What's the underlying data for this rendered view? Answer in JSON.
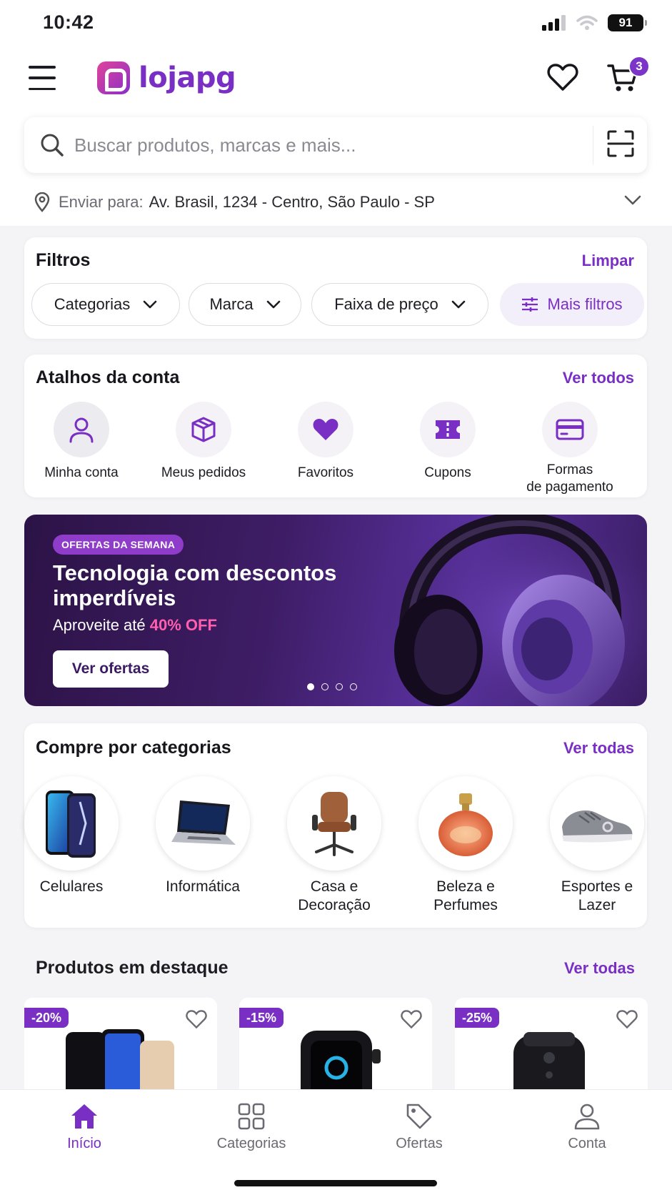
{
  "status_bar": {
    "time": "10:42",
    "battery": "91"
  },
  "header": {
    "logo_text": "lojapg",
    "cart_count": "3"
  },
  "search": {
    "placeholder": "Buscar produtos, marcas e mais...",
    "value": ""
  },
  "address": {
    "label": "Enviar para:",
    "value": "Av. Brasil, 1234 - Centro, São Paulo - SP"
  },
  "filters": {
    "title": "Filtros",
    "clear_label": "Limpar",
    "chips": [
      "Categorias",
      "Marca",
      "Faixa de preço",
      "Mais filtros"
    ]
  },
  "shortcuts": {
    "title": "Atalhos da conta",
    "link": "Ver todos",
    "items": [
      {
        "label": "Minha conta",
        "icon": "user-icon"
      },
      {
        "label": "Meus pedidos",
        "icon": "box-icon"
      },
      {
        "label": "Favoritos",
        "icon": "heart-icon"
      },
      {
        "label": "Cupons",
        "icon": "ticket-icon"
      },
      {
        "label": "Formas\nde pagamento",
        "icon": "credit-card-icon"
      }
    ]
  },
  "banner": {
    "badge": "OFERTAS DA SEMANA",
    "title": "Tecnologia com descontos imperdíveis",
    "subtitle_prefix": "Aproveite até",
    "subtitle_highlight": "40% OFF",
    "button": "Ver ofertas",
    "slides": 4,
    "active_slide": 1
  },
  "categories": {
    "title": "Compre por categorias",
    "link": "Ver todas",
    "items": [
      {
        "label": "Celulares",
        "icon": "smartphone-image"
      },
      {
        "label": "Informática",
        "icon": "laptop-image"
      },
      {
        "label": "Casa e\nDecoração",
        "icon": "chair-image"
      },
      {
        "label": "Beleza e\nPerfumes",
        "icon": "perfume-image"
      },
      {
        "label": "Esportes e\nLazer",
        "icon": "sneaker-image"
      }
    ]
  },
  "featured": {
    "title": "Produtos em destaque",
    "link": "Ver todas",
    "products": [
      {
        "discount": "-20%",
        "icon": "smartphones-image"
      },
      {
        "discount": "-15%",
        "icon": "smartwatch-image"
      },
      {
        "discount": "-25%",
        "icon": "air-fryer-image"
      }
    ]
  },
  "bottom_nav": {
    "items": [
      {
        "label": "Início",
        "icon": "home-icon",
        "active": true
      },
      {
        "label": "Categorias",
        "icon": "grid-icon",
        "active": false
      },
      {
        "label": "Ofertas",
        "icon": "tag-icon",
        "active": false
      },
      {
        "label": "Conta",
        "icon": "user-icon",
        "active": false
      }
    ]
  },
  "colors": {
    "brand": "#7a2fc4",
    "badge": "#7b33c8",
    "highlight": "#ff5fae",
    "background": "#f4f4f7"
  }
}
